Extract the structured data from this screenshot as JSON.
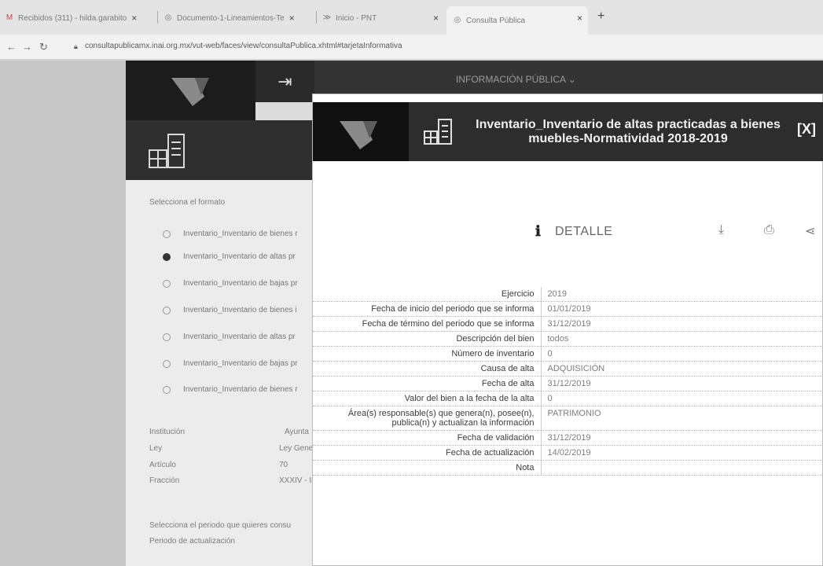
{
  "browser": {
    "tabs": [
      {
        "label": "Recibidos (311) - hilda.garabito",
        "icon": "gmail-icon"
      },
      {
        "label": "Documento-1-Lineamientos-Te",
        "icon": "globe-icon"
      },
      {
        "label": "Inicio - PNT",
        "icon": "pnt-icon"
      },
      {
        "label": "Consulta Pública",
        "icon": "globe-icon"
      }
    ],
    "url": "consultapublicamx.inai.org.mx/vut-web/faces/view/consultaPublica.xhtml#tarjetaInformativa"
  },
  "site": {
    "nav_label": "INFORMACIÓN PÚBLICA",
    "select_format_label": "Selecciona el formato",
    "options": [
      {
        "label": "Inventario_Inventario de bienes r",
        "selected": false
      },
      {
        "label": "Inventario_Inventario de altas pr",
        "selected": true
      },
      {
        "label": "Inventario_Inventario de bajas pr",
        "selected": false
      },
      {
        "label": "Inventario_Inventario de bienes i",
        "selected": false
      },
      {
        "label": "Inventario_Inventario de altas pr",
        "selected": false
      },
      {
        "label": "Inventario_Inventario de bajas pr",
        "selected": false
      },
      {
        "label": "Inventario_Inventario de bienes r",
        "selected": false
      }
    ],
    "meta": [
      {
        "key": "Institución",
        "value": "Ayunta"
      },
      {
        "key": "Ley",
        "value": "Ley Gene"
      },
      {
        "key": "Artículo",
        "value": "70"
      },
      {
        "key": "Fracción",
        "value": "XXXIV - In"
      }
    ],
    "period_prompt": "Selecciona el periodo que quieres consu",
    "period_label": "Periodo de actualización"
  },
  "modal": {
    "title": "Inventario_Inventario de altas practicadas a bienes muebles-Normatividad 2018-2019",
    "close_label": "[X]",
    "detail_label": "DETALLE",
    "rows": [
      {
        "key": "Ejercicio",
        "value": "2019"
      },
      {
        "key": "Fecha de inicio del periodo que se informa",
        "value": "01/01/2019"
      },
      {
        "key": "Fecha de término del periodo que se informa",
        "value": "31/12/2019"
      },
      {
        "key": "Descripción del bien",
        "value": "todos"
      },
      {
        "key": "Número de inventario",
        "value": "0"
      },
      {
        "key": "Causa de alta",
        "value": "ADQUISICIÓN"
      },
      {
        "key": "Fecha de alta",
        "value": "31/12/2019"
      },
      {
        "key": "Valor del bien a la fecha de la alta",
        "value": "0"
      },
      {
        "key": "Área(s) responsable(s) que genera(n), posee(n), publica(n) y actualizan la información",
        "value": "PATRIMONIO"
      },
      {
        "key": "Fecha de validación",
        "value": "31/12/2019"
      },
      {
        "key": "Fecha de actualización",
        "value": "14/02/2019"
      },
      {
        "key": "Nota",
        "value": ""
      }
    ]
  }
}
